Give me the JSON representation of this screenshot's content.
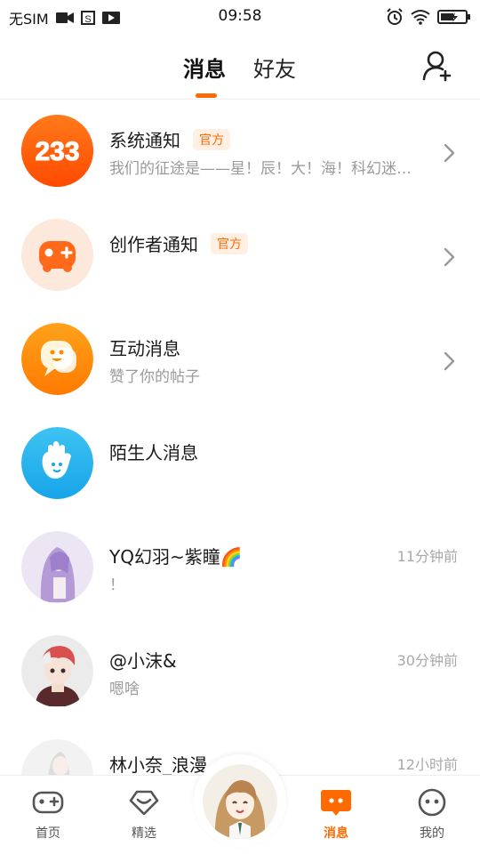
{
  "status_bar": {
    "carrier": "无SIM",
    "time": "09:58",
    "icons": [
      "video-icon",
      "s-square-icon",
      "play-icon",
      "alarm-icon",
      "wifi-icon",
      "battery-charging-icon"
    ]
  },
  "header": {
    "tabs": [
      {
        "label": "消息",
        "active": true
      },
      {
        "label": "好友",
        "active": false
      }
    ],
    "accent": "#ff6a00",
    "add_friend_icon": "add-user-icon"
  },
  "messages": [
    {
      "title": "系统通知",
      "badge": "官方",
      "subtitle": "我们的征途是——星！辰！大！海！科幻迷…",
      "time": "",
      "avatar": "233-logo",
      "has_arrow": true
    },
    {
      "title": "创作者通知",
      "badge": "官方",
      "subtitle": "",
      "time": "",
      "avatar": "gamepad-icon",
      "has_arrow": true
    },
    {
      "title": "互动消息",
      "badge": "",
      "subtitle": "赞了你的帖子",
      "time": "",
      "avatar": "chat-bubble-icon",
      "has_arrow": true
    },
    {
      "title": "陌生人消息",
      "badge": "",
      "subtitle": "",
      "time": "",
      "avatar": "wave-hand-icon",
      "has_arrow": false
    },
    {
      "title": "YQ幻羽~紫瞳🌈",
      "badge": "",
      "subtitle": "！",
      "time": "11分钟前",
      "avatar": "anime-avatar-purple",
      "has_arrow": false
    },
    {
      "title": "@小沫&",
      "badge": "",
      "subtitle": "嗯啥",
      "time": "30分钟前",
      "avatar": "anime-avatar-red",
      "has_arrow": false
    },
    {
      "title": "林小奈_浪漫",
      "badge": "",
      "subtitle": "",
      "time": "12小时前",
      "avatar": "anime-avatar-white",
      "has_arrow": false
    }
  ],
  "bottom_nav": [
    {
      "label": "首页",
      "icon": "gamepad-outline-icon",
      "active": false
    },
    {
      "label": "精选",
      "icon": "heart-diamond-icon",
      "active": false
    },
    {
      "label": "消息",
      "icon": "message-bubble-icon",
      "active": true
    },
    {
      "label": "我的",
      "icon": "smile-face-icon",
      "active": false
    }
  ],
  "center_avatar": "user-avatar"
}
